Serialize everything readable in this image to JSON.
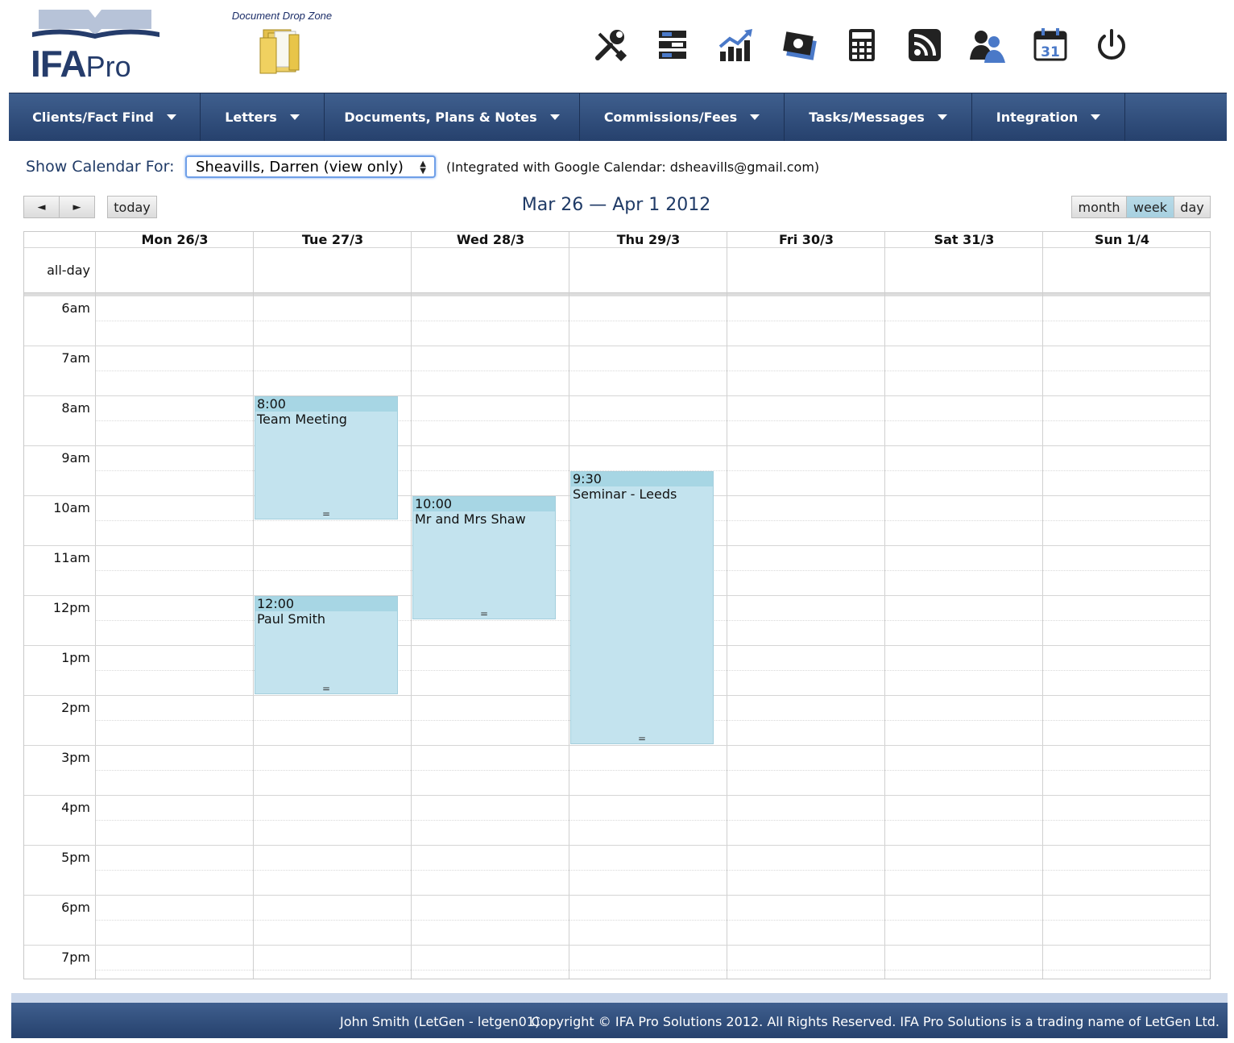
{
  "header": {
    "logo": {
      "bold": "IFA",
      "light": "Pro"
    },
    "dropzone_label": "Document Drop Zone",
    "tools": [
      {
        "icon": "tools-icon"
      },
      {
        "icon": "server-icon"
      },
      {
        "icon": "chart-growth-icon"
      },
      {
        "icon": "banknotes-icon"
      },
      {
        "icon": "calculator-icon"
      },
      {
        "icon": "rss-icon"
      },
      {
        "icon": "users-icon"
      },
      {
        "icon": "calendar-icon",
        "text": "31"
      },
      {
        "icon": "power-icon"
      }
    ]
  },
  "nav": {
    "items": [
      {
        "label": "Clients/Fact Find"
      },
      {
        "label": "Letters"
      },
      {
        "label": "Documents, Plans & Notes"
      },
      {
        "label": "Commissions/Fees"
      },
      {
        "label": "Tasks/Messages"
      },
      {
        "label": "Integration"
      }
    ]
  },
  "calendar_for": {
    "label": "Show Calendar For:",
    "selected": "Sheavills, Darren (view only)",
    "integration_note": "(Integrated with Google Calendar: dsheavills@gmail.com)"
  },
  "controls": {
    "prev": "◄",
    "next": "►",
    "today": "today",
    "title": "Mar 26 — Apr 1 2012",
    "views": [
      {
        "label": "month",
        "active": false
      },
      {
        "label": "week",
        "active": true
      },
      {
        "label": "day",
        "active": false
      }
    ]
  },
  "grid": {
    "days": [
      "Mon 26/3",
      "Tue 27/3",
      "Wed 28/3",
      "Thu 29/3",
      "Fri 30/3",
      "Sat 31/3",
      "Sun 1/4"
    ],
    "allday_label": "all-day",
    "hours": [
      "6am",
      "7am",
      "8am",
      "9am",
      "10am",
      "11am",
      "12pm",
      "1pm",
      "2pm",
      "3pm",
      "4pm",
      "5pm",
      "6pm",
      "7pm"
    ]
  },
  "events": [
    {
      "day": 1,
      "start": "8:00",
      "title": "Team Meeting",
      "start_h": 8.0,
      "end_h": 10.5,
      "grip": "="
    },
    {
      "day": 1,
      "start": "12:00",
      "title": "Paul Smith",
      "start_h": 12.0,
      "end_h": 14.0,
      "grip": "="
    },
    {
      "day": 2,
      "start": "10:00",
      "title": "Mr and Mrs Shaw",
      "start_h": 10.0,
      "end_h": 12.5,
      "grip": "="
    },
    {
      "day": 3,
      "start": "9:30",
      "title": "Seminar - Leeds",
      "start_h": 9.5,
      "end_h": 15.0,
      "grip": "="
    }
  ],
  "footer": {
    "user": "John Smith (LetGen - letgen01)",
    "copyright": "Copyright © IFA Pro Solutions 2012. All Rights Reserved. IFA Pro Solutions is a trading name of LetGen Ltd."
  }
}
